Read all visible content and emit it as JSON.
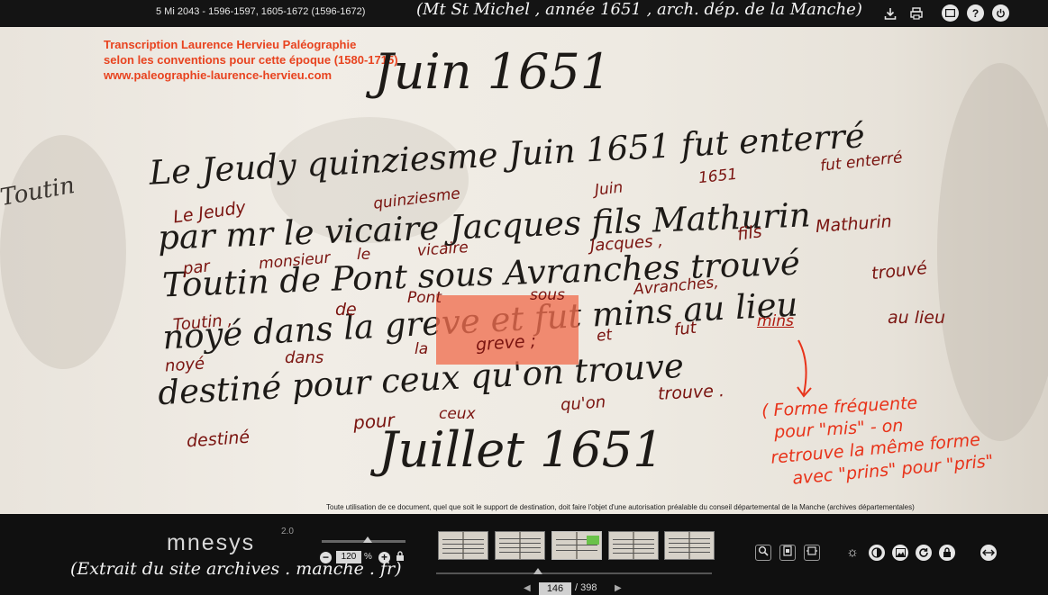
{
  "topbar": {
    "document_title": "5 Mi 2043 - 1596-1597, 1605-1672 (1596-1672)",
    "handwritten_note": "(Mt St Michel , année 1651 , arch. dép. de la Manche)",
    "icons": [
      "download-icon",
      "print-icon",
      "fullscreen-icon",
      "help-icon",
      "power-icon"
    ]
  },
  "viewer": {
    "credit": [
      "Transcription Laurence Hervieu Paléographie",
      "selon les conventions pour cette époque (1580-1715)",
      "www.paleographie-laurence-hervieu.com"
    ],
    "manuscript": {
      "month_heading": "Juin 1651",
      "next_heading": "Juillet 1651",
      "margin_name": "Toutin",
      "lines": [
        "Le Jeudy quinziesme Juin 1651 fut enterré",
        "par mr le vicaire Jacques fils Mathurin",
        "Toutin de Pont sous Avranches trouvé",
        "noyé dans la greve et fut mins au lieu",
        "destiné pour ceux qu'on trouve"
      ]
    },
    "transcription": {
      "le_jeudy": "Le Jeudy",
      "quinziesme": "quinziesme",
      "juin": "Juin",
      "year": "1651",
      "fut_enterre": "fut enterré",
      "fils": "fils",
      "mathurin": "Mathurin",
      "par": "par",
      "monsieur": "monsieur",
      "le": "le",
      "vicaire": "vicaire",
      "jacques": "Jacques ,",
      "trouve": "trouvé",
      "avranches": "Avranches,",
      "toutin": "Toutin ,",
      "de": "de",
      "pont": "Pont",
      "sous": "sous",
      "noye": "noyé",
      "dans": "dans",
      "la": "la",
      "greve": "greve ;",
      "et": "et",
      "fut": "fut",
      "mins": "mins",
      "au_lieu": "au lieu",
      "destine": "destiné",
      "pour": "pour",
      "ceux": "ceux",
      "quon": "qu'on",
      "trouve2": "trouve ."
    },
    "note": [
      "( Forme fréquente",
      "pour \"mis\" - on",
      "retrouve la même forme",
      "avec \"prins\" pour \"pris\""
    ],
    "copyright": "Toute utilisation de ce document, quel que soit le support de destination, doit faire l'objet d'une autorisation préalable du conseil départemental de la Manche (archives départementales)"
  },
  "bottombar": {
    "logo": "mnesys",
    "logo_version": "2.0",
    "site_annotation": "(Extrait du site archives . manche . fr)",
    "zoom_value": "120",
    "zoom_unit": "%",
    "zoom_level_fraction": 0.55,
    "current_page": "146",
    "page_separator": "/",
    "total_pages": "398",
    "tools": [
      "magnifier-icon",
      "fit-page-icon",
      "fit-width-icon",
      "brightness-icon",
      "contrast-icon",
      "image-icon",
      "rotate-icon",
      "lock-icon",
      "pan-icon"
    ]
  },
  "colors": {
    "bar": "#141414",
    "parchment": "#ece7df",
    "transcription_ink": "#7a1410",
    "credit": "#e8431f",
    "highlight": "#f06e50",
    "note": "#e8331a"
  }
}
